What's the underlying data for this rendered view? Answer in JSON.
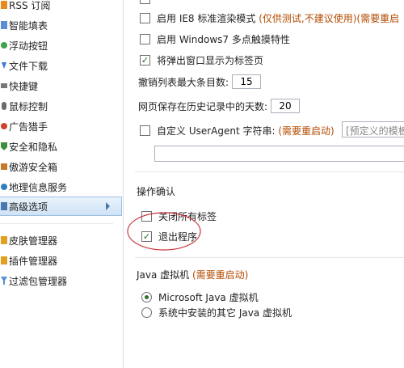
{
  "sidebar": {
    "items": [
      {
        "label": "RSS 订阅",
        "icon": "rss-icon",
        "color": "#e98a1c"
      },
      {
        "label": "智能填表",
        "icon": "form-fill-icon",
        "color": "#5a8fd6"
      },
      {
        "label": "浮动按钮",
        "icon": "float-button-icon",
        "color": "#3fa34d"
      },
      {
        "label": "文件下载",
        "icon": "download-icon",
        "color": "#3a7bd5"
      },
      {
        "label": "快捷键",
        "icon": "keyboard-icon",
        "color": "#777777"
      },
      {
        "label": "鼠标控制",
        "icon": "mouse-icon",
        "color": "#6a6a6a"
      },
      {
        "label": "广告猎手",
        "icon": "ad-hunter-icon",
        "color": "#d0402b"
      },
      {
        "label": "安全和隐私",
        "icon": "shield-icon",
        "color": "#3a8f3a"
      },
      {
        "label": "傲游安全箱",
        "icon": "safe-box-icon",
        "color": "#c7792a"
      },
      {
        "label": "地理信息服务",
        "icon": "globe-icon",
        "color": "#2f7fc2"
      },
      {
        "label": "高级选项",
        "icon": "advanced-icon",
        "color": "#4a78b0"
      },
      {
        "label": "皮肤管理器",
        "icon": "skin-icon",
        "color": "#e0a020"
      },
      {
        "label": "插件管理器",
        "icon": "plugin-icon",
        "color": "#e0a020"
      },
      {
        "label": "过滤包管理器",
        "icon": "filter-icon",
        "color": "#5a8fd6"
      }
    ],
    "selected_index": 10
  },
  "options": {
    "ie8_mode_label": "启用 IE8 标准渲染模式",
    "ie8_mode_note": "(仅供测试,不建议使用)(需要重启",
    "ie8_mode_checked": false,
    "win7_touch_label": "启用 Windows7 多点触摸特性",
    "win7_touch_checked": false,
    "popup_as_tab_label": "将弹出窗口显示为标签页",
    "popup_as_tab_checked": true,
    "undo_list_label": "撤销列表最大条目数:",
    "undo_list_value": "15",
    "history_days_label": "网页保存在历史记录中的天数:",
    "history_days_value": "20",
    "custom_ua_label": "自定义 UserAgent 字符串:",
    "custom_ua_note": "(需要重启动)",
    "custom_ua_checked": false,
    "ua_select_placeholder": "[预定义的模板"
  },
  "confirm": {
    "title": "操作确认",
    "close_all_tabs_label": "关闭所有标签",
    "close_all_tabs_checked": false,
    "exit_program_label": "退出程序",
    "exit_program_checked": true
  },
  "java": {
    "title": "Java 虚拟机",
    "note": "(需要重启动)",
    "options": [
      {
        "label": "Microsoft Java 虚拟机",
        "selected": true
      },
      {
        "label": "系统中安装的其它 Java 虚拟机",
        "selected": false
      }
    ]
  }
}
